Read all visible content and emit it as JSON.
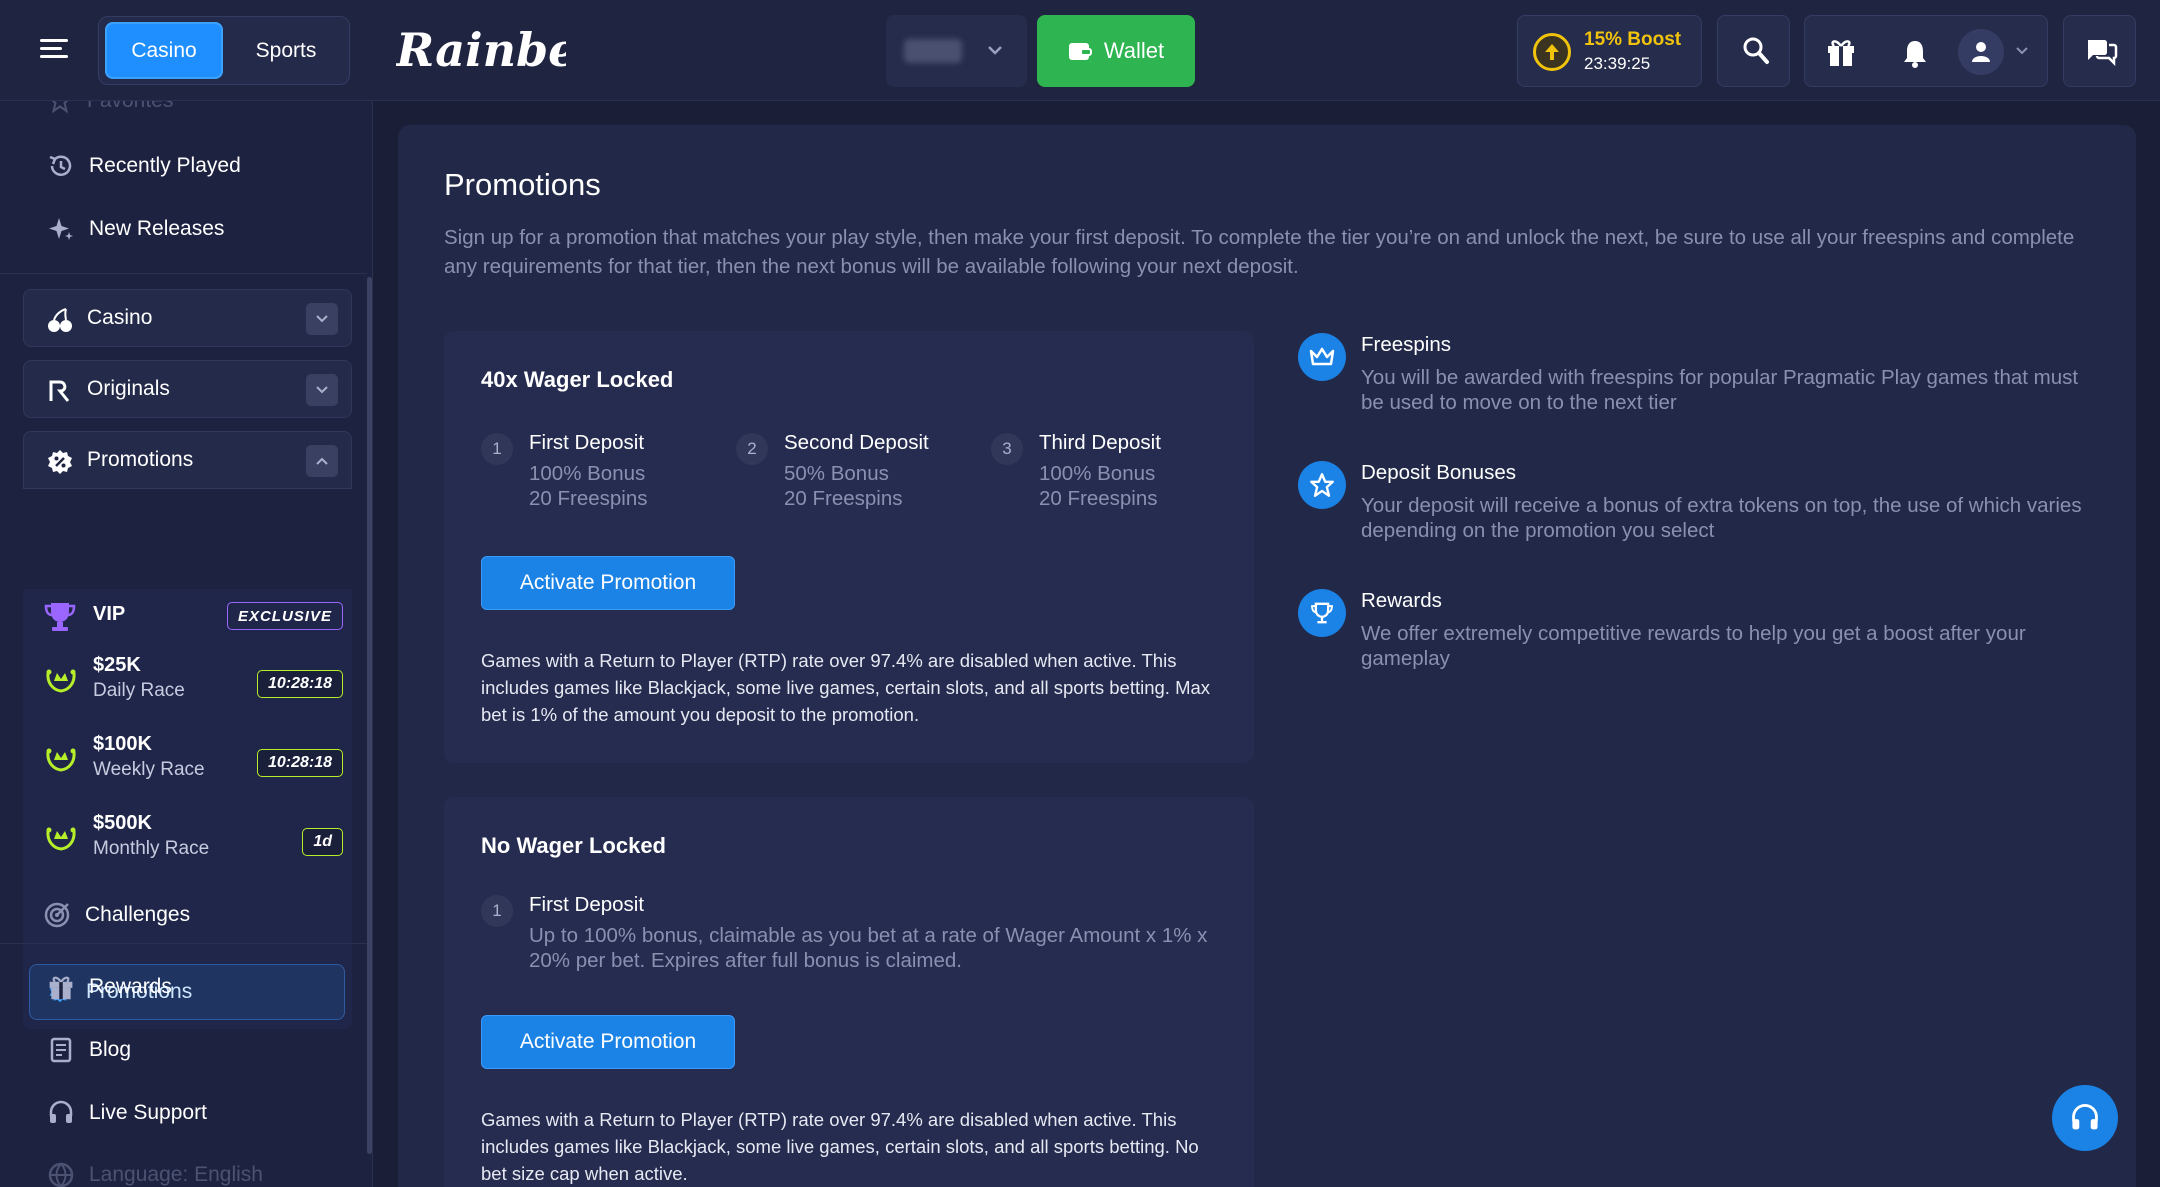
{
  "header": {
    "mode_tabs": [
      "Casino",
      "Sports"
    ],
    "logo_text": "Rainbet",
    "wallet_label": "Wallet",
    "boost_title": "15% Boost",
    "boost_timer": "23:39:25"
  },
  "sidebar": {
    "favorites": "Favorites",
    "recently_played": "Recently Played",
    "new_releases": "New Releases",
    "casino": "Casino",
    "originals": "Originals",
    "promotions": "Promotions",
    "vip": "VIP",
    "exclusive": "EXCLUSIVE",
    "races": [
      {
        "amount": "$25K",
        "name": "Daily Race",
        "timer": "10:28:18"
      },
      {
        "amount": "$100K",
        "name": "Weekly Race",
        "timer": "10:28:18"
      },
      {
        "amount": "$500K",
        "name": "Monthly Race",
        "timer": "1d"
      }
    ],
    "challenges": "Challenges",
    "promotions_active": "Promotions",
    "rewards": "Rewards",
    "blog": "Blog",
    "live_support": "Live Support",
    "language": "Language: English"
  },
  "main": {
    "title": "Promotions",
    "description": "Sign up for a promotion that matches your play style, then make your first deposit. To complete the tier you’re on and unlock the next, be sure to use all your freespins and complete any requirements for that tier, then the next bonus will be available following your next deposit.",
    "cards": [
      {
        "title": "40x Wager Locked",
        "steps": [
          {
            "num": "1",
            "title": "First Deposit",
            "bonus": "100% Bonus",
            "spins": "20 Freespins"
          },
          {
            "num": "2",
            "title": "Second Deposit",
            "bonus": "50% Bonus",
            "spins": "20 Freespins"
          },
          {
            "num": "3",
            "title": "Third Deposit",
            "bonus": "100% Bonus",
            "spins": "20 Freespins"
          }
        ],
        "button": "Activate Promotion",
        "note": "Games with a Return to Player (RTP) rate over 97.4% are disabled when active. This includes games like Blackjack, some live games, certain slots, and all sports betting. Max bet is 1% of the amount you deposit to the promotion."
      },
      {
        "title": "No Wager Locked",
        "step": {
          "num": "1",
          "title": "First Deposit",
          "desc": "Up to 100% bonus, claimable as you bet at a rate of Wager Amount x 1% x 20% per bet. Expires after full bonus is claimed."
        },
        "button": "Activate Promotion",
        "note": "Games with a Return to Player (RTP) rate over 97.4% are disabled when active. This includes games like Blackjack, some live games, certain slots, and all sports betting. No bet size cap when active."
      }
    ],
    "features": [
      {
        "icon": "crown-icon",
        "title": "Freespins",
        "desc": "You will be awarded with freespins for popular Pragmatic Play games that must be used to move on to the next tier"
      },
      {
        "icon": "star-icon",
        "title": "Deposit Bonuses",
        "desc": "Your deposit will receive a bonus of extra tokens on top, the use of which varies depending on the promotion you select"
      },
      {
        "icon": "trophy-icon",
        "title": "Rewards",
        "desc": "We offer extremely competitive rewards to help you get a boost after your gameplay"
      }
    ]
  },
  "colors": {
    "accent": "#1b82e6",
    "wallet": "#2eb450",
    "boost": "#f1c30c",
    "race_timer": "#b6ef2a",
    "vip": "#9a66ff"
  }
}
